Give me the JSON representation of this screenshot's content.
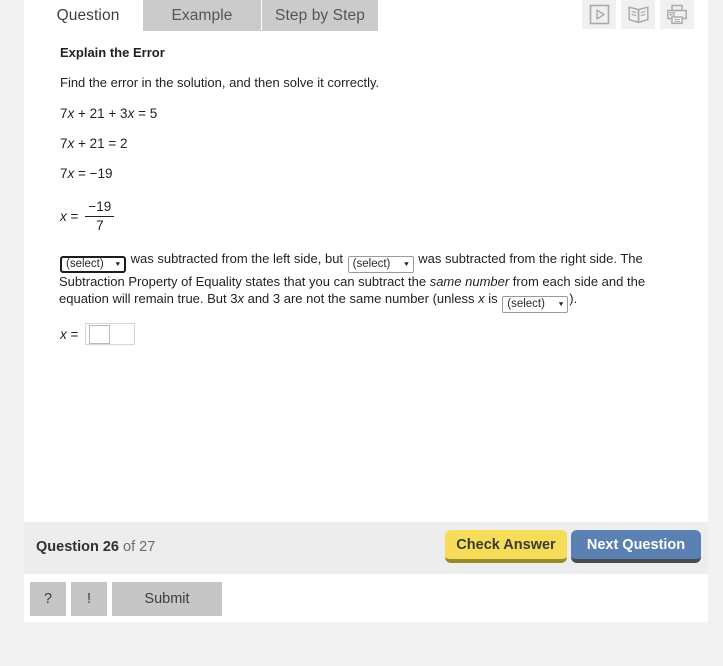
{
  "tabs": [
    {
      "id": "question",
      "label": "Question",
      "active": true
    },
    {
      "id": "example",
      "label": "Example",
      "active": false
    },
    {
      "id": "stepbystep",
      "label": "Step by Step",
      "active": false
    }
  ],
  "tools": [
    {
      "id": "video",
      "icon": "play-video-icon"
    },
    {
      "id": "ebook",
      "icon": "open-book-icon"
    },
    {
      "id": "print",
      "icon": "printer-icon"
    }
  ],
  "question": {
    "title": "Explain the Error",
    "instruction": "Find the error in the solution, and then solve it correctly.",
    "equations": {
      "line1_a": "7",
      "line1_x": "x",
      "line1_b": " + 21 + 3",
      "line1_x2": "x",
      "line1_c": " = 5",
      "line2_a": "7",
      "line2_x": "x",
      "line2_b": " + 21 = 2",
      "line3_a": "7",
      "line3_x": "x",
      "line3_b": " = −19",
      "line4_x": "x",
      "line4_eq": " = ",
      "line4_num": "−19",
      "line4_den": "7"
    },
    "paragraph": {
      "select_placeholder": "(select)",
      "caret_glyph": "⯆",
      "text_1": " was subtracted from the left side, but ",
      "text_2": " was subtracted from the right side. The Subtraction Property of Equality states that you can subtract the ",
      "em_same_number": "same number",
      "text_3": " from each side and the equation will remain true. But 3",
      "x_italic_1": "x",
      "text_4": " and 3 are not the same number (unless ",
      "x_italic_2": "x",
      "text_5": " is ",
      "text_6": ")."
    },
    "answer": {
      "label_x": "x",
      "label_eq": " =",
      "value": ""
    }
  },
  "footer": {
    "counter_prefix": "Question 26",
    "counter_suffix": " of 27",
    "check_answer_label": "Check Answer",
    "next_question_label": "Next Question"
  },
  "bottom_toolbar": {
    "help_label": "?",
    "report_label": "!",
    "submit_label": "Submit"
  },
  "colors": {
    "page_background": "#f2f2f2",
    "panel_background": "#ffffff",
    "tab_inactive": "#cbcbcb",
    "footer_bar": "#ededed",
    "check_answer": "#f5dd59",
    "next_question": "#5b80b2",
    "gray_button": "#c6c6c6",
    "text": "#231f20"
  }
}
